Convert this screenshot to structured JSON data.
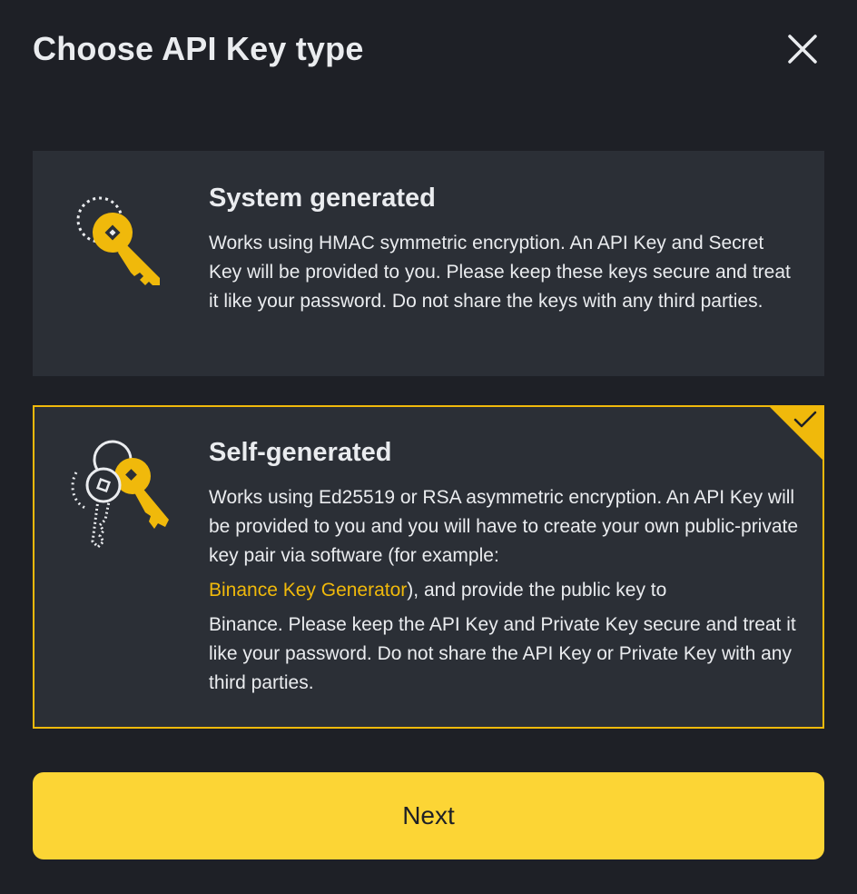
{
  "dialog": {
    "title": "Choose API Key type"
  },
  "options": [
    {
      "heading": "System generated",
      "description": "Works using HMAC symmetric encryption. An API Key and Secret Key will be provided to you. Please keep these keys secure and treat it like your password. Do not share the keys with any third parties.",
      "selected": false
    },
    {
      "heading": "Self-generated",
      "description_line1": "Works using Ed25519 or RSA asymmetric encryption. An API Key will be provided to you and you will have to create your own public-private key pair via software (for example:",
      "link_text": "Binance Key Generator",
      "description_after_link": "), and provide the public key to",
      "description_line5": "Binance. Please keep the API Key and Private Key secure and treat it like your password. Do not share the API Key or Private Key with any third parties.",
      "selected": true
    }
  ],
  "footer": {
    "next_label": "Next"
  },
  "colors": {
    "background": "#1e2026",
    "card": "#2b2f36",
    "accent": "#f0b90b",
    "button": "#fcd535",
    "text": "#eaecef"
  },
  "icons": {
    "close": "close-icon",
    "system_key": "key-icon",
    "self_keys": "key-pair-icon",
    "selected": "checkmark-icon"
  }
}
